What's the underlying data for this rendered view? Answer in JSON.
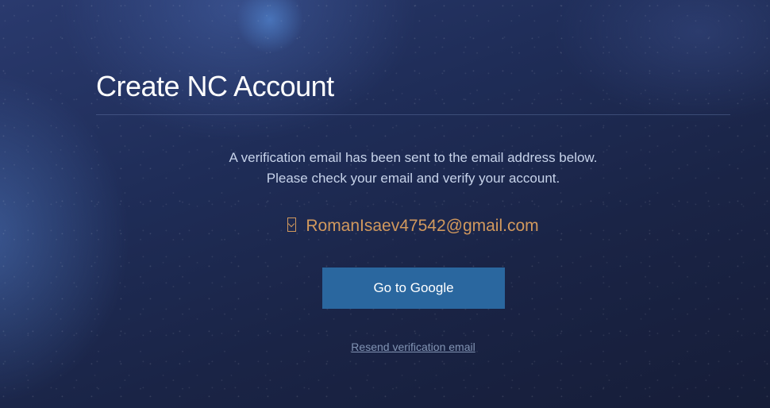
{
  "page": {
    "title": "Create NC Account"
  },
  "verification": {
    "message_line1": "A verification email has been sent to the email address below.",
    "message_line2": "Please check your email and verify your account.",
    "email": "RomanIsaev47542@gmail.com",
    "email_icon": "envelope-icon"
  },
  "actions": {
    "go_button_label": "Go to Google",
    "resend_link_label": "Resend verification email"
  },
  "colors": {
    "button": "#2a679f",
    "email_text": "#d2995d",
    "title_text": "#ffffff"
  }
}
